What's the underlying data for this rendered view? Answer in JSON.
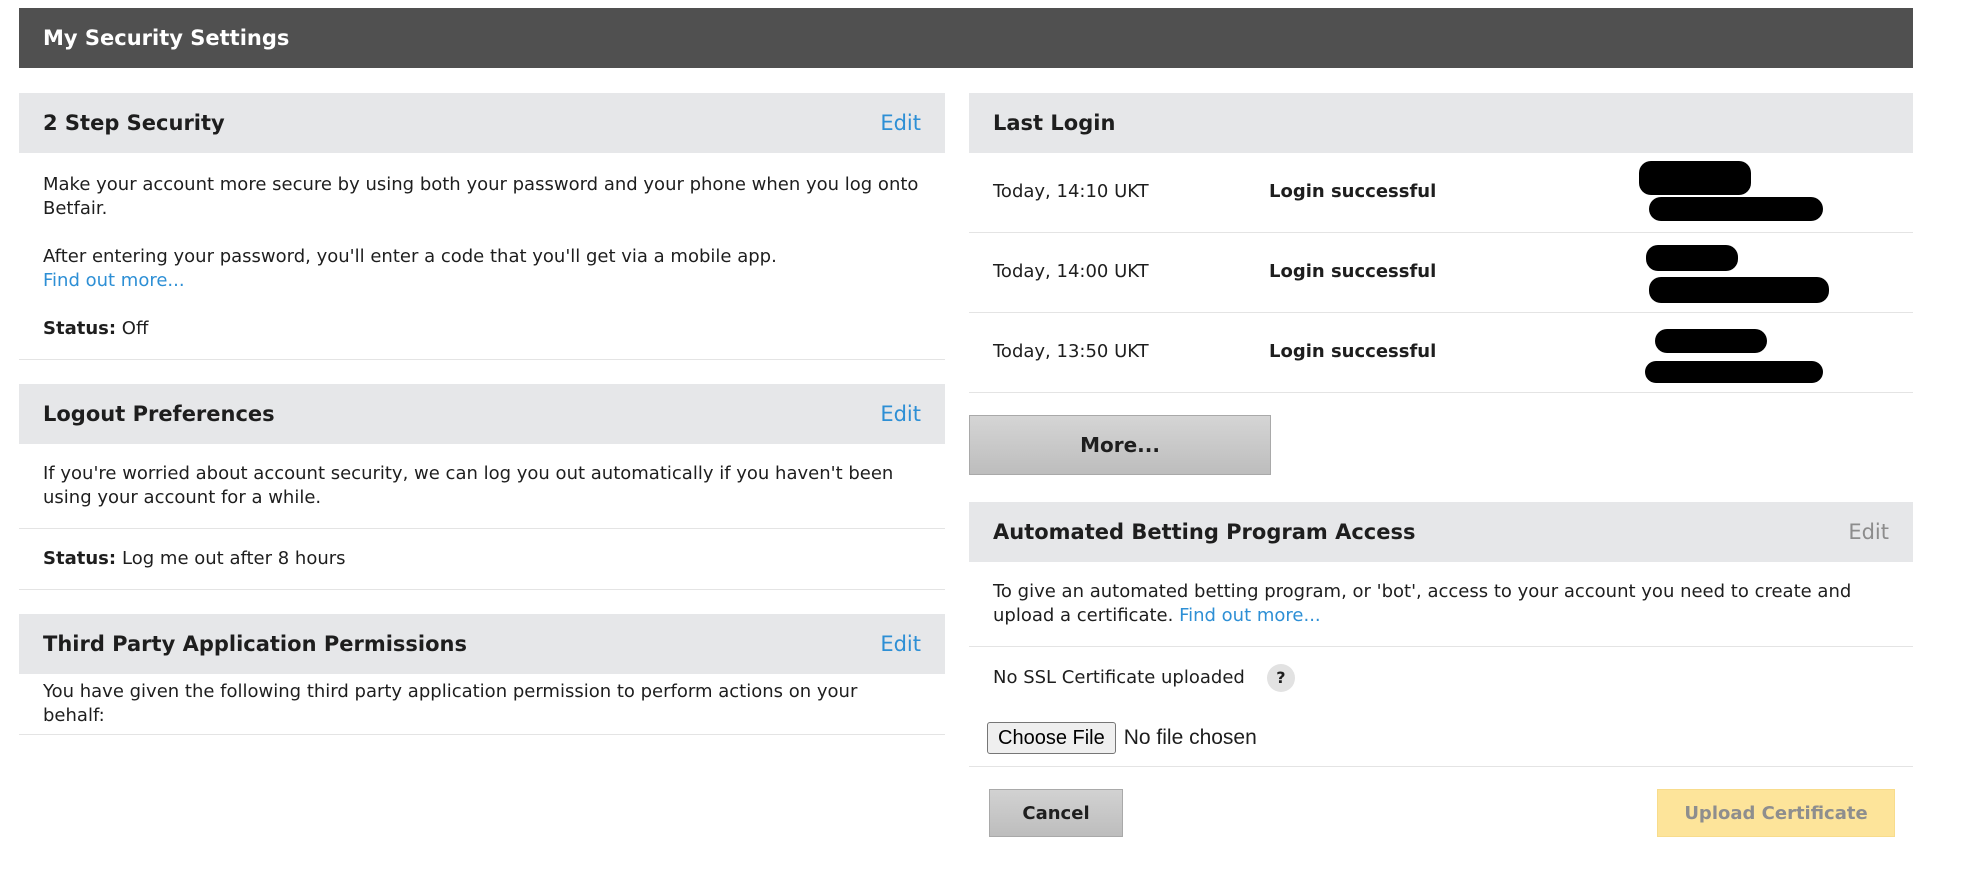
{
  "page_title": "My Security Settings",
  "colors": {
    "header_bg": "#505050",
    "section_bg": "#e6e7e9",
    "link": "#2d8fd5",
    "upload_bg": "#fde49a"
  },
  "two_step": {
    "title": "2 Step Security",
    "edit": "Edit",
    "description": "Make your account more secure by using both your password and your phone when you log onto Betfair.",
    "info": "After entering your password, you'll enter a code that you'll get via a mobile app.",
    "find_out_more": "Find out more...",
    "status_label": "Status:",
    "status_value": "Off"
  },
  "logout": {
    "title": "Logout Preferences",
    "edit": "Edit",
    "description": "If you're worried about account security, we can log you out automatically if you haven't been using your account for a while.",
    "status_label": "Status:",
    "status_value": "Log me out after 8 hours"
  },
  "third_party": {
    "title": "Third Party Application Permissions",
    "edit": "Edit",
    "description": "You have given the following third party application permission to perform actions on your behalf:"
  },
  "last_login": {
    "title": "Last Login",
    "rows": [
      {
        "time": "Today, 14:10 UKT",
        "status": "Login successful"
      },
      {
        "time": "Today, 14:00 UKT",
        "status": "Login successful"
      },
      {
        "time": "Today, 13:50 UKT",
        "status": "Login successful"
      }
    ],
    "more_label": "More..."
  },
  "bot_access": {
    "title": "Automated Betting Program Access",
    "edit": "Edit",
    "description": "To give an automated betting program, or 'bot', access to your account you need to create and upload a certificate.",
    "find_out_more": "Find out more...",
    "certificate_status": "No SSL Certificate uploaded",
    "help": "?",
    "choose_file": "Choose File",
    "no_file": "No file chosen",
    "cancel": "Cancel",
    "upload": "Upload Certificate"
  }
}
